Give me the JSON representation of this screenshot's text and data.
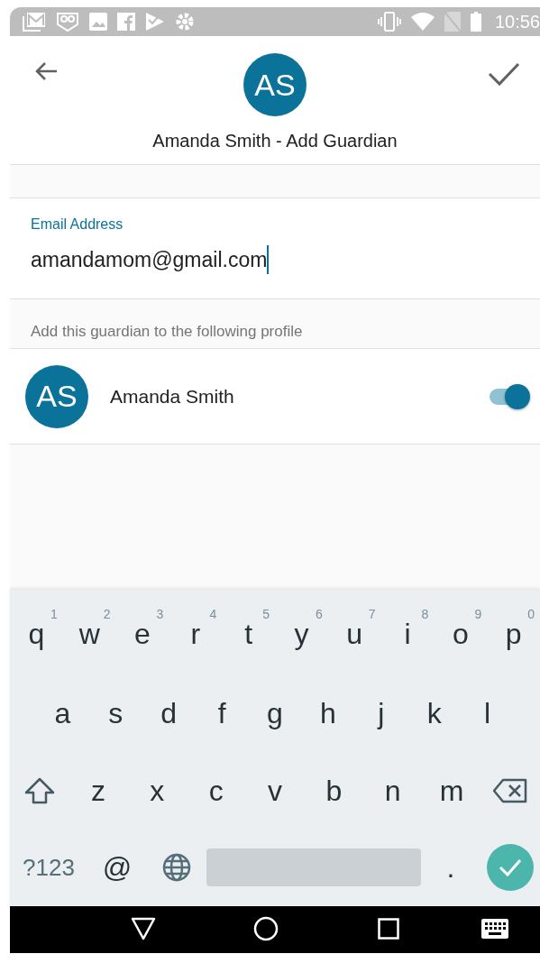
{
  "status_bar": {
    "time": "10:56"
  },
  "header": {
    "initials": "AS",
    "title": "Amanda Smith - Add Guardian"
  },
  "email_field": {
    "label": "Email Address",
    "value": "amandamom@gmail.com"
  },
  "section_header": "Add this guardian to the following profile",
  "profiles": [
    {
      "initials": "AS",
      "name": "Amanda Smith",
      "on": true
    }
  ],
  "keyboard": {
    "rows": [
      [
        {
          "kind": "letter",
          "label": "q",
          "hint": "1"
        },
        {
          "kind": "letter",
          "label": "w",
          "hint": "2"
        },
        {
          "kind": "letter",
          "label": "e",
          "hint": "3"
        },
        {
          "kind": "letter",
          "label": "r",
          "hint": "4"
        },
        {
          "kind": "letter",
          "label": "t",
          "hint": "5"
        },
        {
          "kind": "letter",
          "label": "y",
          "hint": "6"
        },
        {
          "kind": "letter",
          "label": "u",
          "hint": "7"
        },
        {
          "kind": "letter",
          "label": "i",
          "hint": "8"
        },
        {
          "kind": "letter",
          "label": "o",
          "hint": "9"
        },
        {
          "kind": "letter",
          "label": "p",
          "hint": "0"
        }
      ],
      [
        {
          "kind": "letter",
          "label": "a"
        },
        {
          "kind": "letter",
          "label": "s"
        },
        {
          "kind": "letter",
          "label": "d"
        },
        {
          "kind": "letter",
          "label": "f"
        },
        {
          "kind": "letter",
          "label": "g"
        },
        {
          "kind": "letter",
          "label": "h"
        },
        {
          "kind": "letter",
          "label": "j"
        },
        {
          "kind": "letter",
          "label": "k"
        },
        {
          "kind": "letter",
          "label": "l"
        }
      ],
      [
        {
          "kind": "shift"
        },
        {
          "kind": "letter",
          "label": "z"
        },
        {
          "kind": "letter",
          "label": "x"
        },
        {
          "kind": "letter",
          "label": "c"
        },
        {
          "kind": "letter",
          "label": "v"
        },
        {
          "kind": "letter",
          "label": "b"
        },
        {
          "kind": "letter",
          "label": "n"
        },
        {
          "kind": "letter",
          "label": "m"
        },
        {
          "kind": "backspace"
        }
      ],
      [
        {
          "kind": "symbols",
          "label": "?123"
        },
        {
          "kind": "letter",
          "label": "@"
        },
        {
          "kind": "globe"
        },
        {
          "kind": "space"
        },
        {
          "kind": "letter",
          "label": "."
        },
        {
          "kind": "enter"
        }
      ]
    ]
  }
}
